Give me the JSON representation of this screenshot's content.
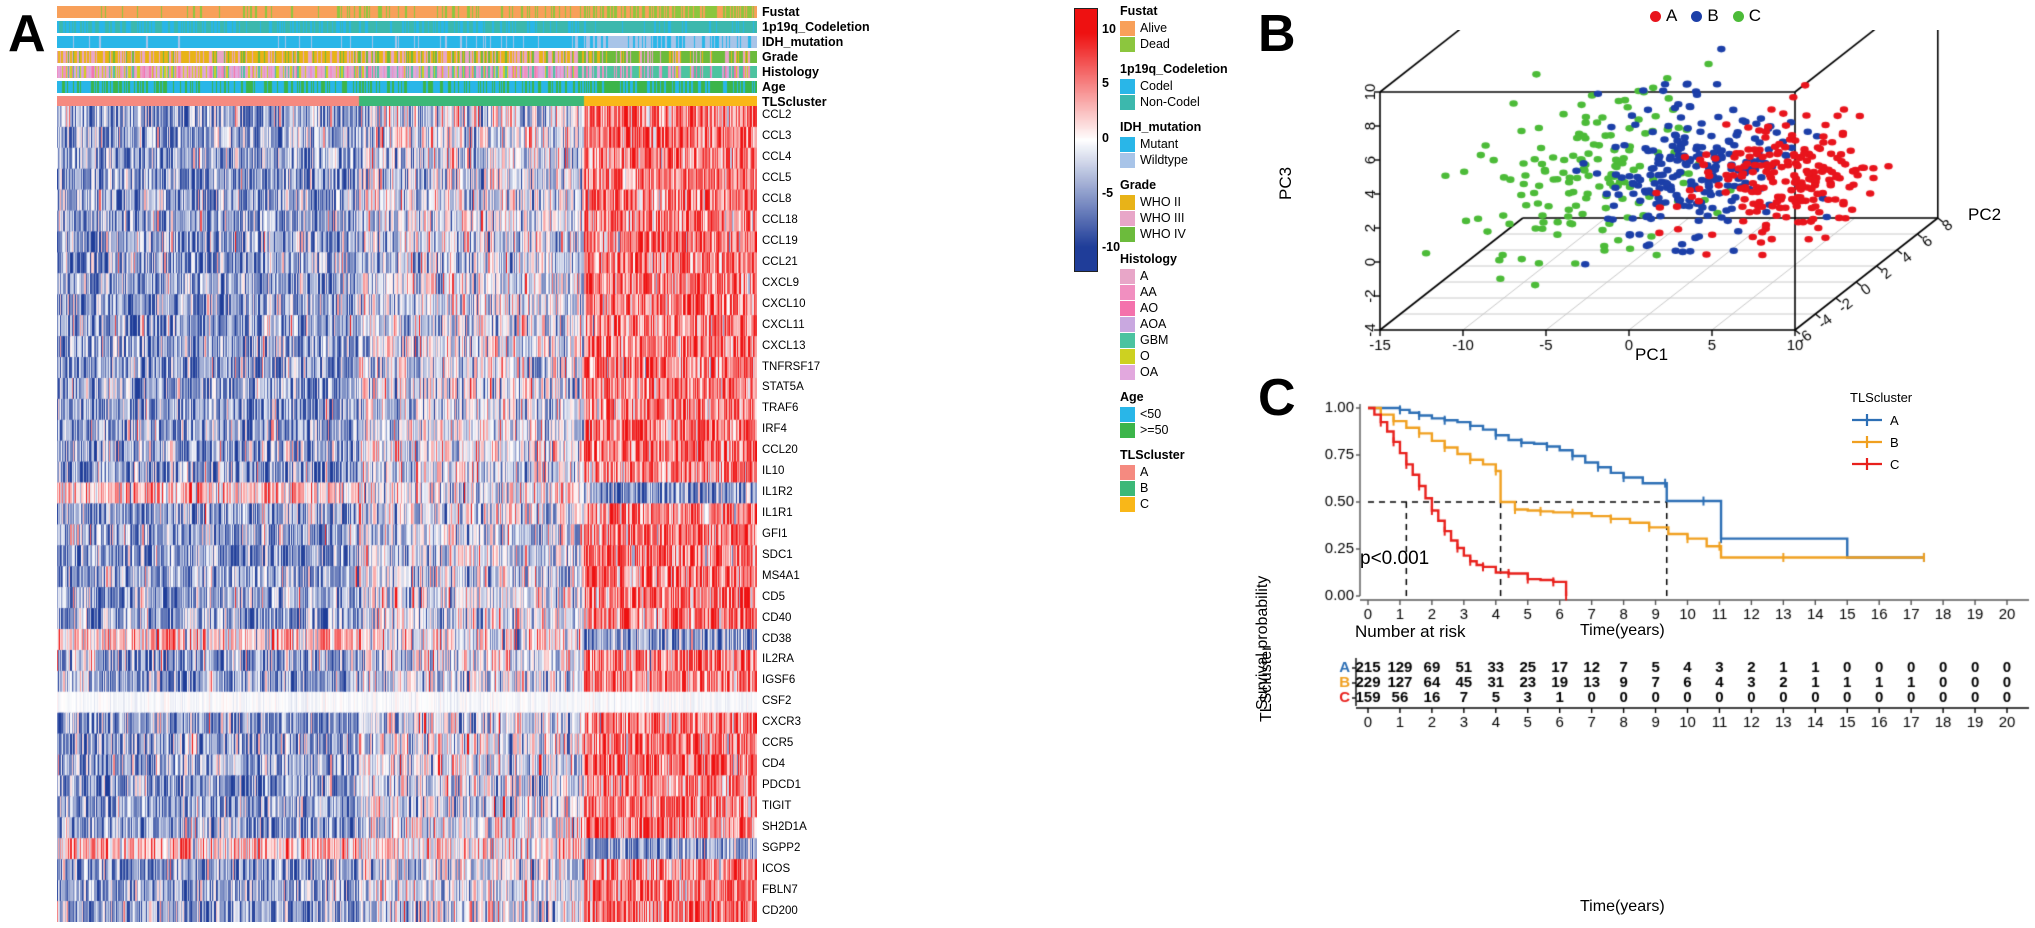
{
  "panels": {
    "a_letter": "A",
    "b_letter": "B",
    "c_letter": "C"
  },
  "heatmap": {
    "annotation_tracks": [
      {
        "name": "Fustat"
      },
      {
        "name": "1p19q_Codeletion"
      },
      {
        "name": "IDH_mutation"
      },
      {
        "name": "Grade"
      },
      {
        "name": "Histology"
      },
      {
        "name": "Age"
      },
      {
        "name": "TLScluster"
      }
    ],
    "genes": [
      "CCL2",
      "CCL3",
      "CCL4",
      "CCL5",
      "CCL8",
      "CCL18",
      "CCL19",
      "CCL21",
      "CXCL9",
      "CXCL10",
      "CXCL11",
      "CXCL13",
      "TNFRSF17",
      "STAT5A",
      "TRAF6",
      "IRF4",
      "CCL20",
      "IL10",
      "IL1R2",
      "IL1R1",
      "GFI1",
      "SDC1",
      "MS4A1",
      "CD5",
      "CD40",
      "CD38",
      "IL2RA",
      "IGSF6",
      "CSF2",
      "CXCR3",
      "CCR5",
      "CD4",
      "PDCD1",
      "TIGIT",
      "SH2D1A",
      "SGPP2",
      "ICOS",
      "FBLN7",
      "CD200"
    ],
    "colorbar": {
      "ticks": [
        "10",
        "5",
        "0",
        "-5",
        "-10"
      ],
      "min": -12,
      "max": 12,
      "low_color": "#1f3d99",
      "mid_color": "#ffffff",
      "high_color": "#ee1111"
    },
    "legends": [
      {
        "title": "Fustat",
        "items": [
          {
            "label": "Alive",
            "color": "#f8a05a"
          },
          {
            "label": "Dead",
            "color": "#8cc63e"
          }
        ]
      },
      {
        "title": "1p19q_Codeletion",
        "items": [
          {
            "label": "Codel",
            "color": "#29b6e8"
          },
          {
            "label": "Non-Codel",
            "color": "#3cb8ad"
          }
        ]
      },
      {
        "title": "IDH_mutation",
        "items": [
          {
            "label": "Mutant",
            "color": "#29b6e8"
          },
          {
            "label": "Wildtype",
            "color": "#a8c4e8"
          }
        ]
      },
      {
        "title": "Grade",
        "items": [
          {
            "label": "WHO II",
            "color": "#e8b318"
          },
          {
            "label": "WHO III",
            "color": "#e8a6c8"
          },
          {
            "label": "WHO IV",
            "color": "#6cbb3c"
          }
        ]
      },
      {
        "title": "Histology",
        "items": [
          {
            "label": "A",
            "color": "#e8a6c8"
          },
          {
            "label": "AA",
            "color": "#f18fc0"
          },
          {
            "label": "AO",
            "color": "#f472ac"
          },
          {
            "label": "AOA",
            "color": "#c9a8e0"
          },
          {
            "label": "GBM",
            "color": "#4cc3a0"
          },
          {
            "label": "O",
            "color": "#cdd121"
          },
          {
            "label": "OA",
            "color": "#e2a8de"
          }
        ]
      },
      {
        "title": "Age",
        "items": [
          {
            "label": "<50",
            "color": "#29b6e8"
          },
          {
            "label": ">=50",
            "color": "#3cb54a"
          }
        ]
      },
      {
        "title": "TLScluster",
        "items": [
          {
            "label": "A",
            "color": "#f58a80"
          },
          {
            "label": "B",
            "color": "#3cb878"
          },
          {
            "label": "C",
            "color": "#f9b718"
          }
        ]
      }
    ]
  },
  "pca": {
    "legend": [
      {
        "label": "A",
        "color": "#e8141c"
      },
      {
        "label": "B",
        "color": "#1c3fa8"
      },
      {
        "label": "C",
        "color": "#4cbb38"
      }
    ],
    "axes": {
      "pc1_label": "PC1",
      "pc2_label": "PC2",
      "pc3_label": "PC3",
      "pc1_ticks": [
        "-15",
        "-10",
        "-5",
        "0",
        "5",
        "10"
      ],
      "pc2_ticks": [
        "-6",
        "-4",
        "-2",
        "0",
        "2",
        "4",
        "6",
        "8"
      ],
      "pc3_ticks": [
        "-4",
        "-2",
        "0",
        "2",
        "4",
        "6",
        "8",
        "10"
      ]
    },
    "chart_data": {
      "type": "scatter",
      "title": "",
      "xlabel": "PC1",
      "ylabel": "PC3",
      "zlabel": "PC2",
      "xlim": [
        -15,
        10
      ],
      "ylim": [
        -4,
        10
      ],
      "zlim": [
        -6,
        8
      ],
      "series": [
        {
          "name": "A",
          "color": "#e8141c",
          "n": 215,
          "centroid": [
            5.0,
            1.8,
            1.0
          ],
          "spread": [
            2.6,
            1.7,
            1.8
          ]
        },
        {
          "name": "B",
          "color": "#1c3fa8",
          "n": 229,
          "centroid": [
            -0.5,
            2.2,
            0.5
          ],
          "spread": [
            2.8,
            1.9,
            2.0
          ]
        },
        {
          "name": "C",
          "color": "#4cbb38",
          "n": 159,
          "centroid": [
            -6.5,
            2.2,
            0.0
          ],
          "spread": [
            3.4,
            2.4,
            2.4
          ]
        }
      ]
    }
  },
  "km": {
    "ylabel": "Survival probability",
    "xlabel": "Time(years)",
    "pvalue": "p<0.001",
    "legend_title": "TLScluster",
    "legend": [
      {
        "label": "A",
        "color": "#2d6fb5"
      },
      {
        "label": "B",
        "color": "#f0a020"
      },
      {
        "label": "C",
        "color": "#e8201c"
      }
    ],
    "y_ticks": [
      "1.00",
      "0.75",
      "0.50",
      "0.25",
      "0.00"
    ],
    "x_ticks": [
      "0",
      "1",
      "2",
      "3",
      "4",
      "5",
      "6",
      "7",
      "8",
      "9",
      "10",
      "11",
      "12",
      "13",
      "14",
      "15",
      "16",
      "17",
      "18",
      "19",
      "20"
    ],
    "median_lines": [
      1.2,
      4.15,
      9.35
    ],
    "risk_table": {
      "title": "Number at risk",
      "ylabel": "TLScluster",
      "xlabel": "Time(years)",
      "row_labels": [
        "A",
        "B",
        "C"
      ],
      "row_colors": [
        "#2d6fb5",
        "#f0a020",
        "#e8201c"
      ],
      "times": [
        "0",
        "1",
        "2",
        "3",
        "4",
        "5",
        "6",
        "7",
        "8",
        "9",
        "10",
        "11",
        "12",
        "13",
        "14",
        "15",
        "16",
        "17",
        "18",
        "19",
        "20"
      ],
      "rows": [
        [
          215,
          129,
          69,
          51,
          33,
          25,
          17,
          12,
          7,
          5,
          4,
          3,
          2,
          1,
          1,
          0,
          0,
          0,
          0,
          0,
          0
        ],
        [
          229,
          127,
          64,
          45,
          31,
          23,
          19,
          13,
          9,
          7,
          6,
          4,
          3,
          2,
          1,
          1,
          1,
          1,
          0,
          0,
          0
        ],
        [
          159,
          56,
          16,
          7,
          5,
          3,
          1,
          0,
          0,
          0,
          0,
          0,
          0,
          0,
          0,
          0,
          0,
          0,
          0,
          0,
          0
        ]
      ]
    },
    "chart_data": {
      "type": "line",
      "title": "",
      "xlabel": "Time(years)",
      "ylabel": "Survival probability",
      "xlim": [
        0,
        20
      ],
      "ylim": [
        0,
        1
      ],
      "series": [
        {
          "name": "A",
          "color": "#2d6fb5",
          "x": [
            0,
            0.6,
            1.0,
            1.3,
            1.6,
            2.0,
            2.4,
            2.8,
            3.2,
            3.6,
            4.0,
            4.4,
            4.8,
            5.2,
            5.6,
            6.0,
            6.4,
            6.8,
            7.2,
            7.6,
            8.0,
            8.6,
            9.3,
            9.35,
            10.5,
            11.0,
            11.05,
            15.0,
            17.4
          ],
          "y": [
            1.0,
            1.0,
            0.99,
            0.975,
            0.96,
            0.945,
            0.935,
            0.925,
            0.905,
            0.885,
            0.855,
            0.83,
            0.815,
            0.81,
            0.795,
            0.775,
            0.745,
            0.71,
            0.685,
            0.655,
            0.63,
            0.6,
            0.6,
            0.505,
            0.505,
            0.505,
            0.305,
            0.205,
            0.205
          ]
        },
        {
          "name": "B",
          "color": "#f0a020",
          "x": [
            0,
            0.4,
            0.8,
            1.2,
            1.6,
            2.0,
            2.4,
            2.8,
            3.2,
            3.6,
            4.0,
            4.15,
            4.6,
            5.0,
            5.4,
            5.8,
            6.4,
            7.0,
            7.6,
            8.2,
            8.8,
            9.4,
            10.0,
            10.6,
            11.0,
            11.05,
            13.0,
            15.0,
            17.4
          ],
          "y": [
            1.0,
            0.965,
            0.93,
            0.895,
            0.865,
            0.825,
            0.79,
            0.755,
            0.725,
            0.7,
            0.665,
            0.5,
            0.46,
            0.455,
            0.45,
            0.445,
            0.44,
            0.425,
            0.41,
            0.39,
            0.365,
            0.33,
            0.305,
            0.265,
            0.265,
            0.205,
            0.205,
            0.205,
            0.205
          ]
        },
        {
          "name": "C",
          "color": "#e8201c",
          "x": [
            0,
            0.2,
            0.4,
            0.6,
            0.8,
            1.0,
            1.2,
            1.4,
            1.6,
            1.8,
            2.0,
            2.2,
            2.4,
            2.6,
            2.8,
            3.0,
            3.2,
            3.4,
            3.6,
            4.0,
            4.4,
            4.8,
            5.0,
            5.4,
            5.8,
            6.1,
            6.2
          ],
          "y": [
            1.0,
            0.965,
            0.925,
            0.875,
            0.82,
            0.76,
            0.7,
            0.645,
            0.585,
            0.52,
            0.455,
            0.4,
            0.345,
            0.295,
            0.255,
            0.215,
            0.185,
            0.165,
            0.155,
            0.125,
            0.12,
            0.12,
            0.09,
            0.085,
            0.075,
            0.075,
            0.0
          ]
        }
      ]
    }
  }
}
